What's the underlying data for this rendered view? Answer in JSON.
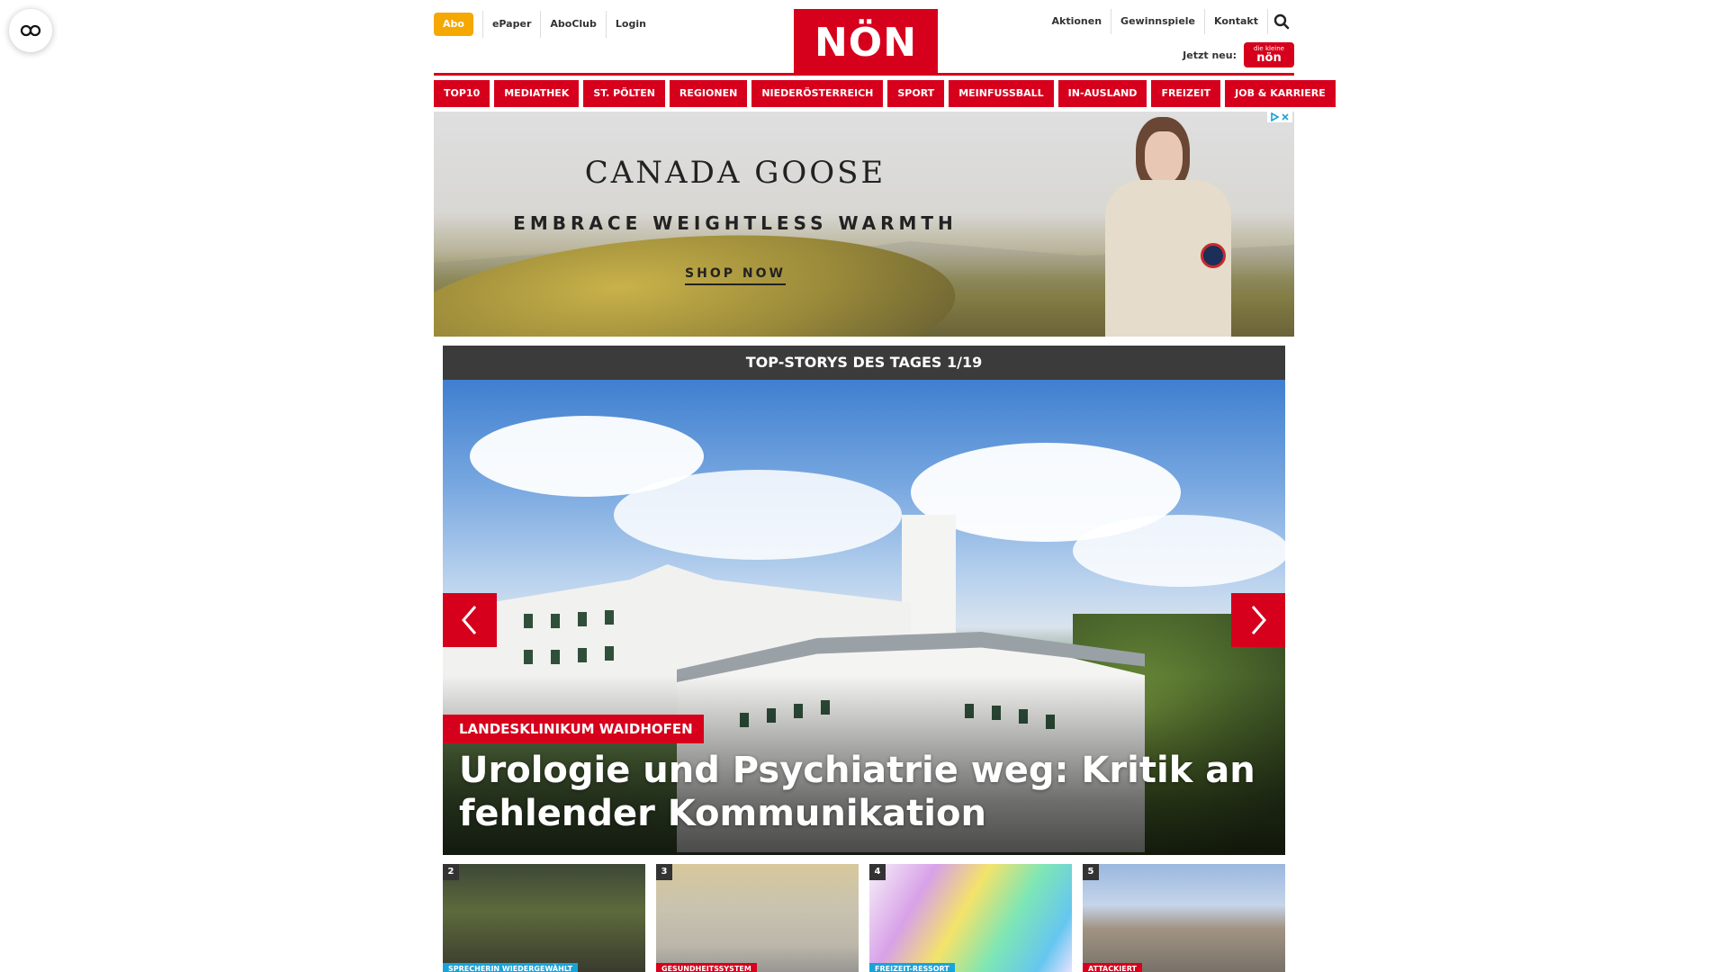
{
  "header": {
    "abo_label": "Abo",
    "left_links": [
      "ePaper",
      "AboClub",
      "Login"
    ],
    "logo_text": "NÖN",
    "right_links": [
      "Aktionen",
      "Gewinnspiele",
      "Kontakt"
    ],
    "jetzt_neu_label": "Jetzt neu:",
    "kleine_logo_top": "die kleine",
    "kleine_logo_main": "nön"
  },
  "nav": {
    "items": [
      "TOP10",
      "MEDIATHEK",
      "ST. PÖLTEN",
      "REGIONEN",
      "NIEDERÖSTERREICH",
      "SPORT",
      "MEINFUSSBALL",
      "IN-AUSLAND",
      "FREIZEIT",
      "JOB & KARRIERE"
    ]
  },
  "ad": {
    "brand": "CANADA GOOSE",
    "slogan": "EMBRACE WEIGHTLESS WARMTH",
    "cta": "SHOP NOW"
  },
  "top_stories": {
    "header": "TOP-STORYS DES TAGES 1/19",
    "hero": {
      "kicker": "LANDESKLINIKUM WAIDHOFEN",
      "title": "Urologie und Psychiatrie weg: Kritik an fehlender Kommunikation"
    },
    "thumbs": [
      {
        "num": "2",
        "tag": "SPRECHERIN WIEDERGEWÄHLT",
        "tag_color": "#1aa3d9"
      },
      {
        "num": "3",
        "tag": "GESUNDHEITSSYSTEM",
        "tag_color": "#d6001c"
      },
      {
        "num": "4",
        "tag": "FREIZEIT-RESSORT",
        "tag_color": "#1aa3d9"
      },
      {
        "num": "5",
        "tag": "ATTACKIERT",
        "tag_color": "#d6001c"
      }
    ]
  },
  "colors": {
    "brand_red": "#d6001c",
    "abo_orange": "#f5a800",
    "header_dark": "#3b3b3b"
  },
  "icons": {
    "accessibility": "accessibility-icon",
    "search": "search-icon",
    "arrow_left": "chevron-left-icon",
    "arrow_right": "chevron-right-icon"
  }
}
